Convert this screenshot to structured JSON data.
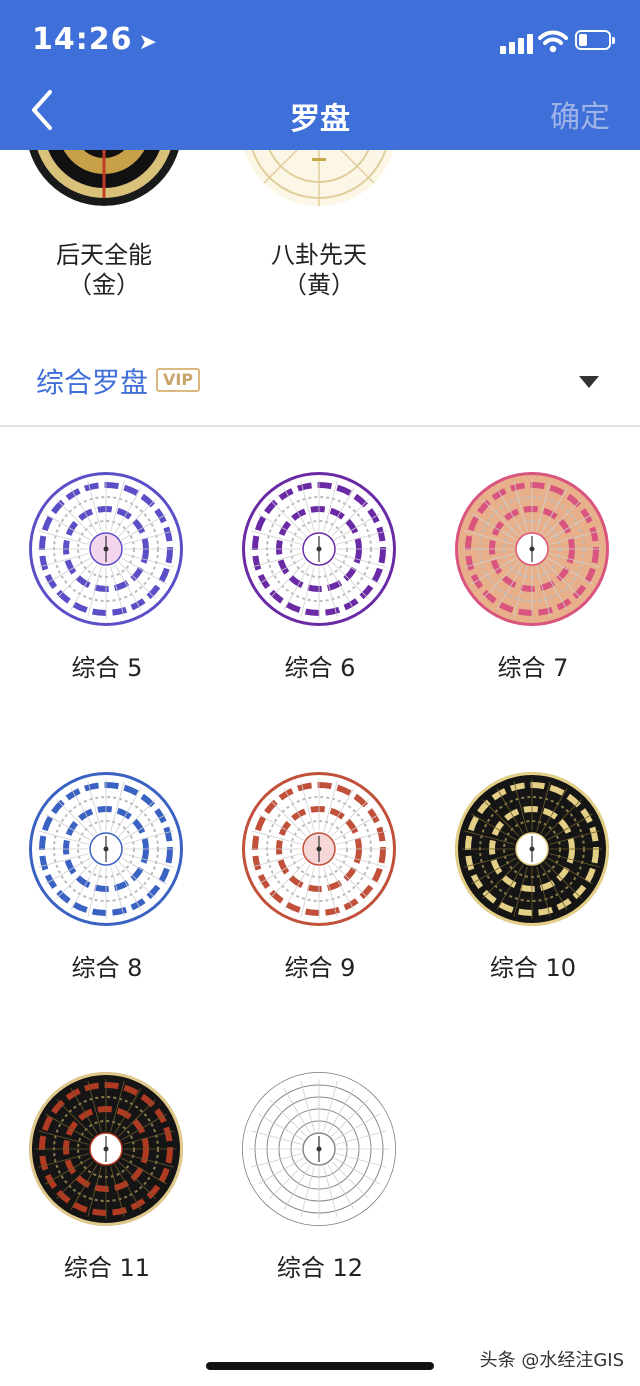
{
  "status_bar": {
    "time": "14:26"
  },
  "nav": {
    "title": "罗盘",
    "confirm_label": "确定"
  },
  "prev_section": {
    "items": [
      {
        "name_line1": "后天全能",
        "name_line2": "（金）"
      },
      {
        "name_line1": "八卦先天",
        "name_line2": "（黄）"
      }
    ]
  },
  "section": {
    "title": "综合罗盘",
    "badge": "VIP"
  },
  "compasses": [
    {
      "label": "综合 5",
      "color": "#5b4fc7"
    },
    {
      "label": "综合 6",
      "color": "#6a2aa6"
    },
    {
      "label": "综合 7",
      "color": "#d9547e"
    },
    {
      "label": "综合 8",
      "color": "#3a62c2"
    },
    {
      "label": "综合 9",
      "color": "#c0503a"
    },
    {
      "label": "综合 10",
      "color": "#e4cf86"
    },
    {
      "label": "综合 11",
      "color": "#b03a22"
    },
    {
      "label": "综合 12",
      "color": "#9a9a9a"
    }
  ],
  "watermark": "头条 @水经注GIS"
}
